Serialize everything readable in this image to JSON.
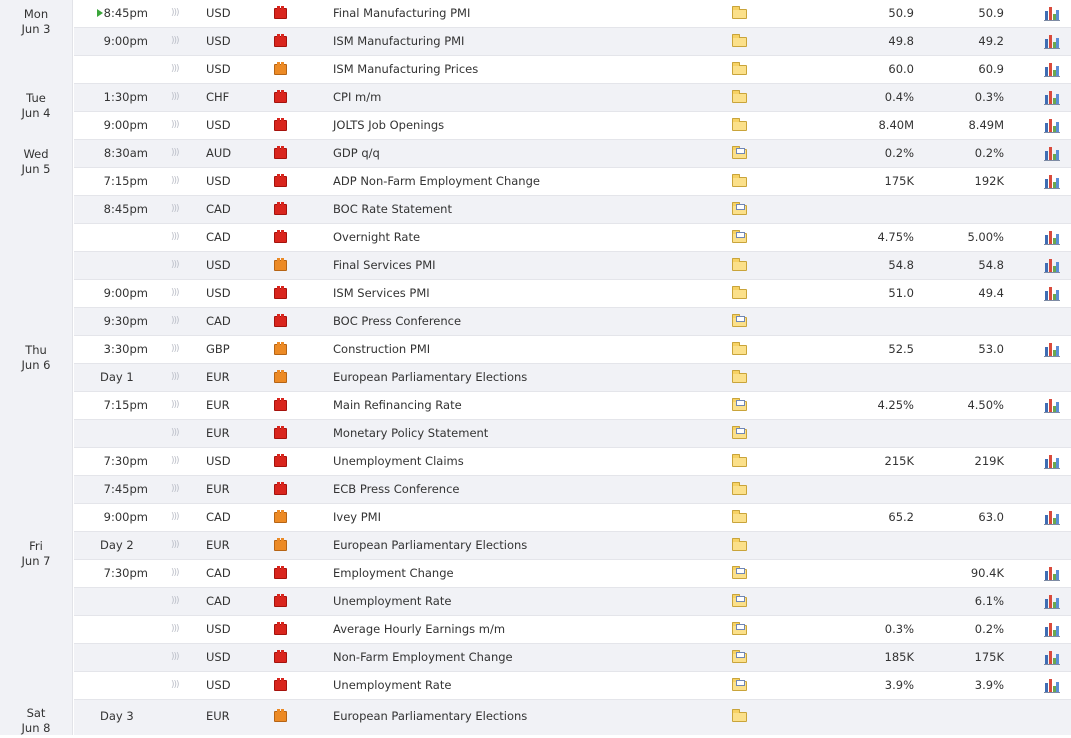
{
  "days": [
    {
      "weekday": "Mon",
      "date": "Jun 3",
      "rows": [
        {
          "time": "8:45pm",
          "playing": true,
          "currency": "USD",
          "impact": "high",
          "event": "Final Manufacturing PMI",
          "report": "folder",
          "forecast": "50.9",
          "previous": "50.9",
          "chart": true
        },
        {
          "time": "9:00pm",
          "currency": "USD",
          "impact": "high",
          "event": "ISM Manufacturing PMI",
          "report": "folder",
          "forecast": "49.8",
          "previous": "49.2",
          "chart": true
        },
        {
          "time": "",
          "currency": "USD",
          "impact": "medium",
          "event": "ISM Manufacturing Prices",
          "report": "folder",
          "forecast": "60.0",
          "previous": "60.9",
          "chart": true
        }
      ]
    },
    {
      "weekday": "Tue",
      "date": "Jun 4",
      "rows": [
        {
          "time": "1:30pm",
          "currency": "CHF",
          "impact": "high",
          "event": "CPI m/m",
          "report": "folder",
          "forecast": "0.4%",
          "previous": "0.3%",
          "chart": true
        },
        {
          "time": "9:00pm",
          "currency": "USD",
          "impact": "high",
          "event": "JOLTS Job Openings",
          "report": "folder",
          "forecast": "8.40M",
          "previous": "8.49M",
          "chart": true
        }
      ]
    },
    {
      "weekday": "Wed",
      "date": "Jun 5",
      "rows": [
        {
          "time": "8:30am",
          "currency": "AUD",
          "impact": "high",
          "event": "GDP q/q",
          "report": "folder-doc",
          "forecast": "0.2%",
          "previous": "0.2%",
          "chart": true
        },
        {
          "time": "7:15pm",
          "currency": "USD",
          "impact": "high",
          "event": "ADP Non-Farm Employment Change",
          "report": "folder",
          "forecast": "175K",
          "previous": "192K",
          "chart": true
        },
        {
          "time": "8:45pm",
          "currency": "CAD",
          "impact": "high",
          "event": "BOC Rate Statement",
          "report": "folder-doc",
          "forecast": "",
          "previous": "",
          "chart": false
        },
        {
          "time": "",
          "currency": "CAD",
          "impact": "high",
          "event": "Overnight Rate",
          "report": "folder-doc",
          "forecast": "4.75%",
          "previous": "5.00%",
          "chart": true
        },
        {
          "time": "",
          "currency": "USD",
          "impact": "medium",
          "event": "Final Services PMI",
          "report": "folder",
          "forecast": "54.8",
          "previous": "54.8",
          "chart": true
        },
        {
          "time": "9:00pm",
          "currency": "USD",
          "impact": "high",
          "event": "ISM Services PMI",
          "report": "folder",
          "forecast": "51.0",
          "previous": "49.4",
          "chart": true
        },
        {
          "time": "9:30pm",
          "currency": "CAD",
          "impact": "high",
          "event": "BOC Press Conference",
          "report": "folder-doc",
          "forecast": "",
          "previous": "",
          "chart": false
        }
      ]
    },
    {
      "weekday": "Thu",
      "date": "Jun 6",
      "rows": [
        {
          "time": "3:30pm",
          "currency": "GBP",
          "impact": "medium",
          "event": "Construction PMI",
          "report": "folder",
          "forecast": "52.5",
          "previous": "53.0",
          "chart": true
        },
        {
          "time": "Day 1",
          "daytag": true,
          "currency": "EUR",
          "impact": "medium",
          "event": "European Parliamentary Elections",
          "report": "folder",
          "forecast": "",
          "previous": "",
          "chart": false
        },
        {
          "time": "7:15pm",
          "currency": "EUR",
          "impact": "high",
          "event": "Main Refinancing Rate",
          "report": "folder-doc",
          "forecast": "4.25%",
          "previous": "4.50%",
          "chart": true
        },
        {
          "time": "",
          "currency": "EUR",
          "impact": "high",
          "event": "Monetary Policy Statement",
          "report": "folder-doc",
          "forecast": "",
          "previous": "",
          "chart": false
        },
        {
          "time": "7:30pm",
          "currency": "USD",
          "impact": "high",
          "event": "Unemployment Claims",
          "report": "folder",
          "forecast": "215K",
          "previous": "219K",
          "chart": true
        },
        {
          "time": "7:45pm",
          "currency": "EUR",
          "impact": "high",
          "event": "ECB Press Conference",
          "report": "folder",
          "forecast": "",
          "previous": "",
          "chart": false
        },
        {
          "time": "9:00pm",
          "currency": "CAD",
          "impact": "medium",
          "event": "Ivey PMI",
          "report": "folder",
          "forecast": "65.2",
          "previous": "63.0",
          "chart": true
        }
      ]
    },
    {
      "weekday": "Fri",
      "date": "Jun 7",
      "rows": [
        {
          "time": "Day 2",
          "daytag": true,
          "currency": "EUR",
          "impact": "medium",
          "event": "European Parliamentary Elections",
          "report": "folder",
          "forecast": "",
          "previous": "",
          "chart": false
        },
        {
          "time": "7:30pm",
          "currency": "CAD",
          "impact": "high",
          "event": "Employment Change",
          "report": "folder-doc",
          "forecast": "",
          "previous": "90.4K",
          "chart": true
        },
        {
          "time": "",
          "currency": "CAD",
          "impact": "high",
          "event": "Unemployment Rate",
          "report": "folder-doc",
          "forecast": "",
          "previous": "6.1%",
          "chart": true
        },
        {
          "time": "",
          "currency": "USD",
          "impact": "high",
          "event": "Average Hourly Earnings m/m",
          "report": "folder-doc",
          "forecast": "0.3%",
          "previous": "0.2%",
          "chart": true
        },
        {
          "time": "",
          "currency": "USD",
          "impact": "high",
          "event": "Non-Farm Employment Change",
          "report": "folder-doc",
          "forecast": "185K",
          "previous": "175K",
          "chart": true
        },
        {
          "time": "",
          "currency": "USD",
          "impact": "high",
          "event": "Unemployment Rate",
          "report": "folder-doc",
          "forecast": "3.9%",
          "previous": "3.9%",
          "chart": true
        }
      ]
    },
    {
      "weekday": "Sat",
      "date": "Jun 8",
      "rows": [
        {
          "time": "Day 3",
          "daytag": true,
          "currency": "EUR",
          "impact": "medium",
          "event": "European Parliamentary Elections",
          "report": "folder",
          "forecast": "",
          "previous": "",
          "chart": false
        }
      ]
    }
  ]
}
